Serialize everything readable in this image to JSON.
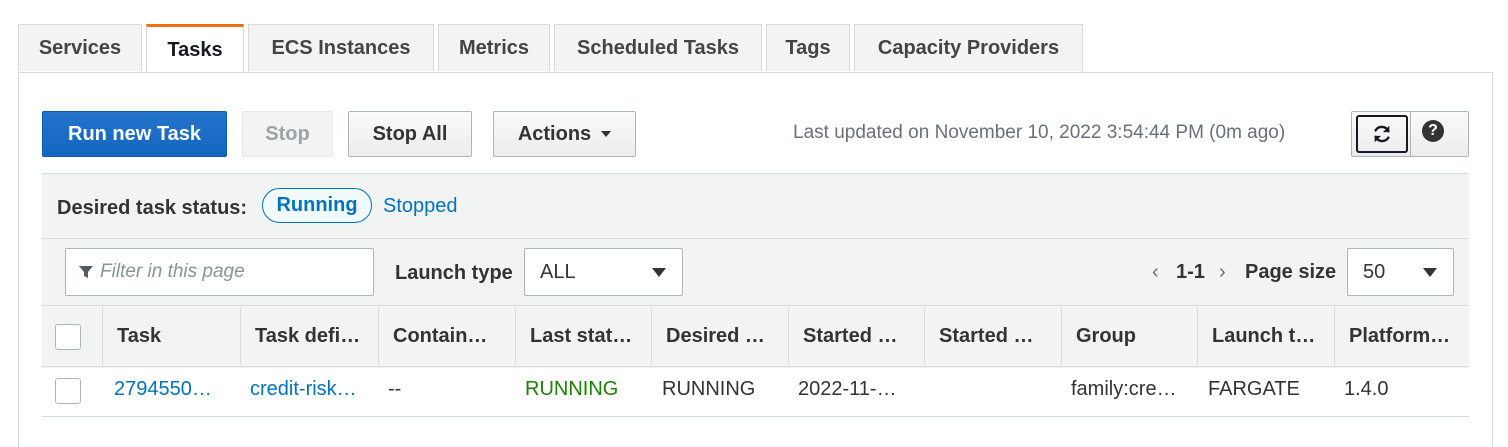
{
  "tabs": [
    "Services",
    "Tasks",
    "ECS Instances",
    "Metrics",
    "Scheduled Tasks",
    "Tags",
    "Capacity Providers"
  ],
  "active_tab": "Tasks",
  "toolbar": {
    "run_label": "Run new Task",
    "stop_label": "Stop",
    "stop_all_label": "Stop All",
    "actions_label": "Actions",
    "last_updated": "Last updated on November 10, 2022 3:54:44 PM (0m ago)",
    "refresh_icon": "refresh-icon",
    "help_icon": "help-icon",
    "help_glyph": "?"
  },
  "status_filter": {
    "label": "Desired task status:",
    "running": "Running",
    "stopped": "Stopped"
  },
  "filter": {
    "placeholder": "Filter in this page",
    "launch_type_label": "Launch type",
    "launch_type_value": "ALL",
    "pagination": "1-1",
    "page_size_label": "Page size",
    "page_size_value": "50"
  },
  "table": {
    "columns": [
      "Task",
      "Task defi…",
      "Contain…",
      "Last stat…",
      "Desired …",
      "Started …",
      "Started …",
      "Group",
      "Launch t…",
      "Platform…"
    ],
    "rows": [
      {
        "task": "2794550…",
        "task_definition": "credit-risk…",
        "container": "--",
        "last_status": "RUNNING",
        "desired_status": "RUNNING",
        "started_at": "2022-11-…",
        "started_by": "",
        "group": "family:cre…",
        "launch_type": "FARGATE",
        "platform": "1.4.0"
      }
    ]
  },
  "colors": {
    "accent_tab": "#ec7211",
    "primary": "#1566c0",
    "link": "#0073bb",
    "running": "#1d8102"
  }
}
